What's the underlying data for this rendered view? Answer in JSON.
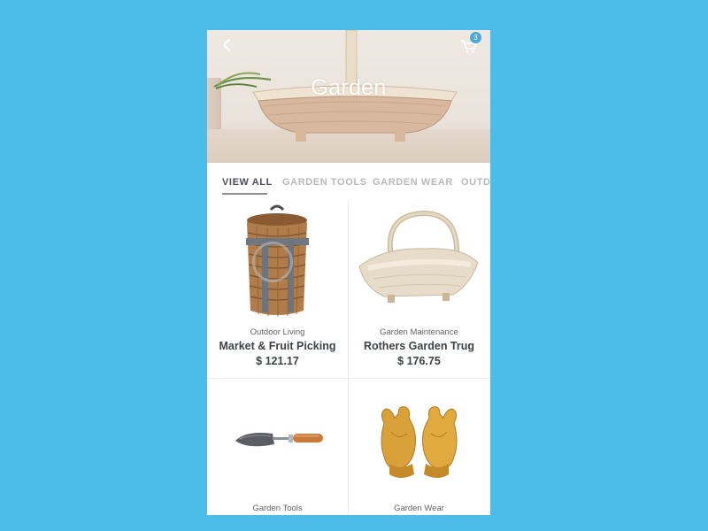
{
  "header": {
    "title": "Garden",
    "cart_count": "3"
  },
  "tabs": [
    {
      "label": "VIEW ALL",
      "active": true
    },
    {
      "label": "GARDEN TOOLS",
      "active": false
    },
    {
      "label": "GARDEN WEAR",
      "active": false
    },
    {
      "label": "OUTDO",
      "active": false
    }
  ],
  "products": [
    {
      "category": "Outdoor Living",
      "name": "Market & Fruit Picking",
      "price": "$ 121.17",
      "icon": "wicker-backpack-basket"
    },
    {
      "category": "Garden Maintenance",
      "name": "Rothers Garden Trug",
      "price": "$ 176.75",
      "icon": "wooden-trug-basket"
    },
    {
      "category": "Garden Tools",
      "name": "",
      "price": "",
      "icon": "hand-trowel"
    },
    {
      "category": "Garden Wear",
      "name": "",
      "price": "",
      "icon": "leather-gloves"
    }
  ],
  "colors": {
    "background": "#4bbde8",
    "badge": "#4aa9d8",
    "text_dark": "#3c414a",
    "tab_inactive": "#b8b8b8"
  }
}
